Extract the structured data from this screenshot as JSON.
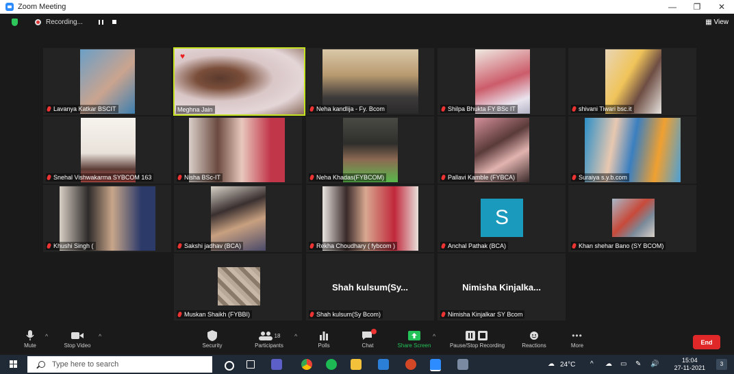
{
  "window": {
    "title": "Zoom Meeting",
    "minimize": "—",
    "restore": "❐",
    "close": "✕"
  },
  "meeting_bar": {
    "recording_label": "Recording...",
    "view_label": "View"
  },
  "tiles": [
    {
      "name": "Lavanya Katkar  BSCIT"
    },
    {
      "name": "Meghna Jain"
    },
    {
      "name": "Neha kandlija - Fy. Bcom"
    },
    {
      "name": "Shilpa Bhukta FY BSc IT"
    },
    {
      "name": "shivani Tiwari bsc.it"
    },
    {
      "name": "Snehal Vishwakarma SYBCOM 163"
    },
    {
      "name": "Nisha BSc-IT"
    },
    {
      "name": "Neha Khadas(FYBCOM)"
    },
    {
      "name": "Pallavi Kamble (FYBCA)"
    },
    {
      "name": "Suraiya s.y.b.com"
    },
    {
      "name": "Khushi Singh ("
    },
    {
      "name": "Sakshi jadhav (BCA)"
    },
    {
      "name": "Rekha Choudhary ( fybcom )"
    },
    {
      "name": "Anchal Pathak (BCA)",
      "avatar_letter": "S"
    },
    {
      "name": "Khan shehar Bano (SY BCOM)"
    },
    {
      "name": "Muskan Shaikh (FYBBI)"
    },
    {
      "name": "Shah kulsum(Sy Bcom)",
      "big": "Shah  kulsum(Sy..."
    },
    {
      "name": "Nimisha Kinjalkar SY Bcom",
      "big": "Nimisha  Kinjalka..."
    }
  ],
  "toolbar": {
    "mute": "Mute",
    "stop_video": "Stop Video",
    "security": "Security",
    "participants": "Participants",
    "participants_count": "18",
    "polls": "Polls",
    "chat": "Chat",
    "share_screen": "Share Screen",
    "pause_recording": "Pause/Stop Recording",
    "reactions": "Reactions",
    "more": "More",
    "end": "End"
  },
  "taskbar": {
    "search_placeholder": "Type here to search",
    "temperature": "24°C",
    "time": "15:04",
    "date": "27-11-2021",
    "notification_count": "3"
  },
  "colors": {
    "active_speaker": "#c6e31f",
    "share_green": "#23c35a",
    "end_red": "#e02828",
    "avatar": "#1a9bbd"
  }
}
